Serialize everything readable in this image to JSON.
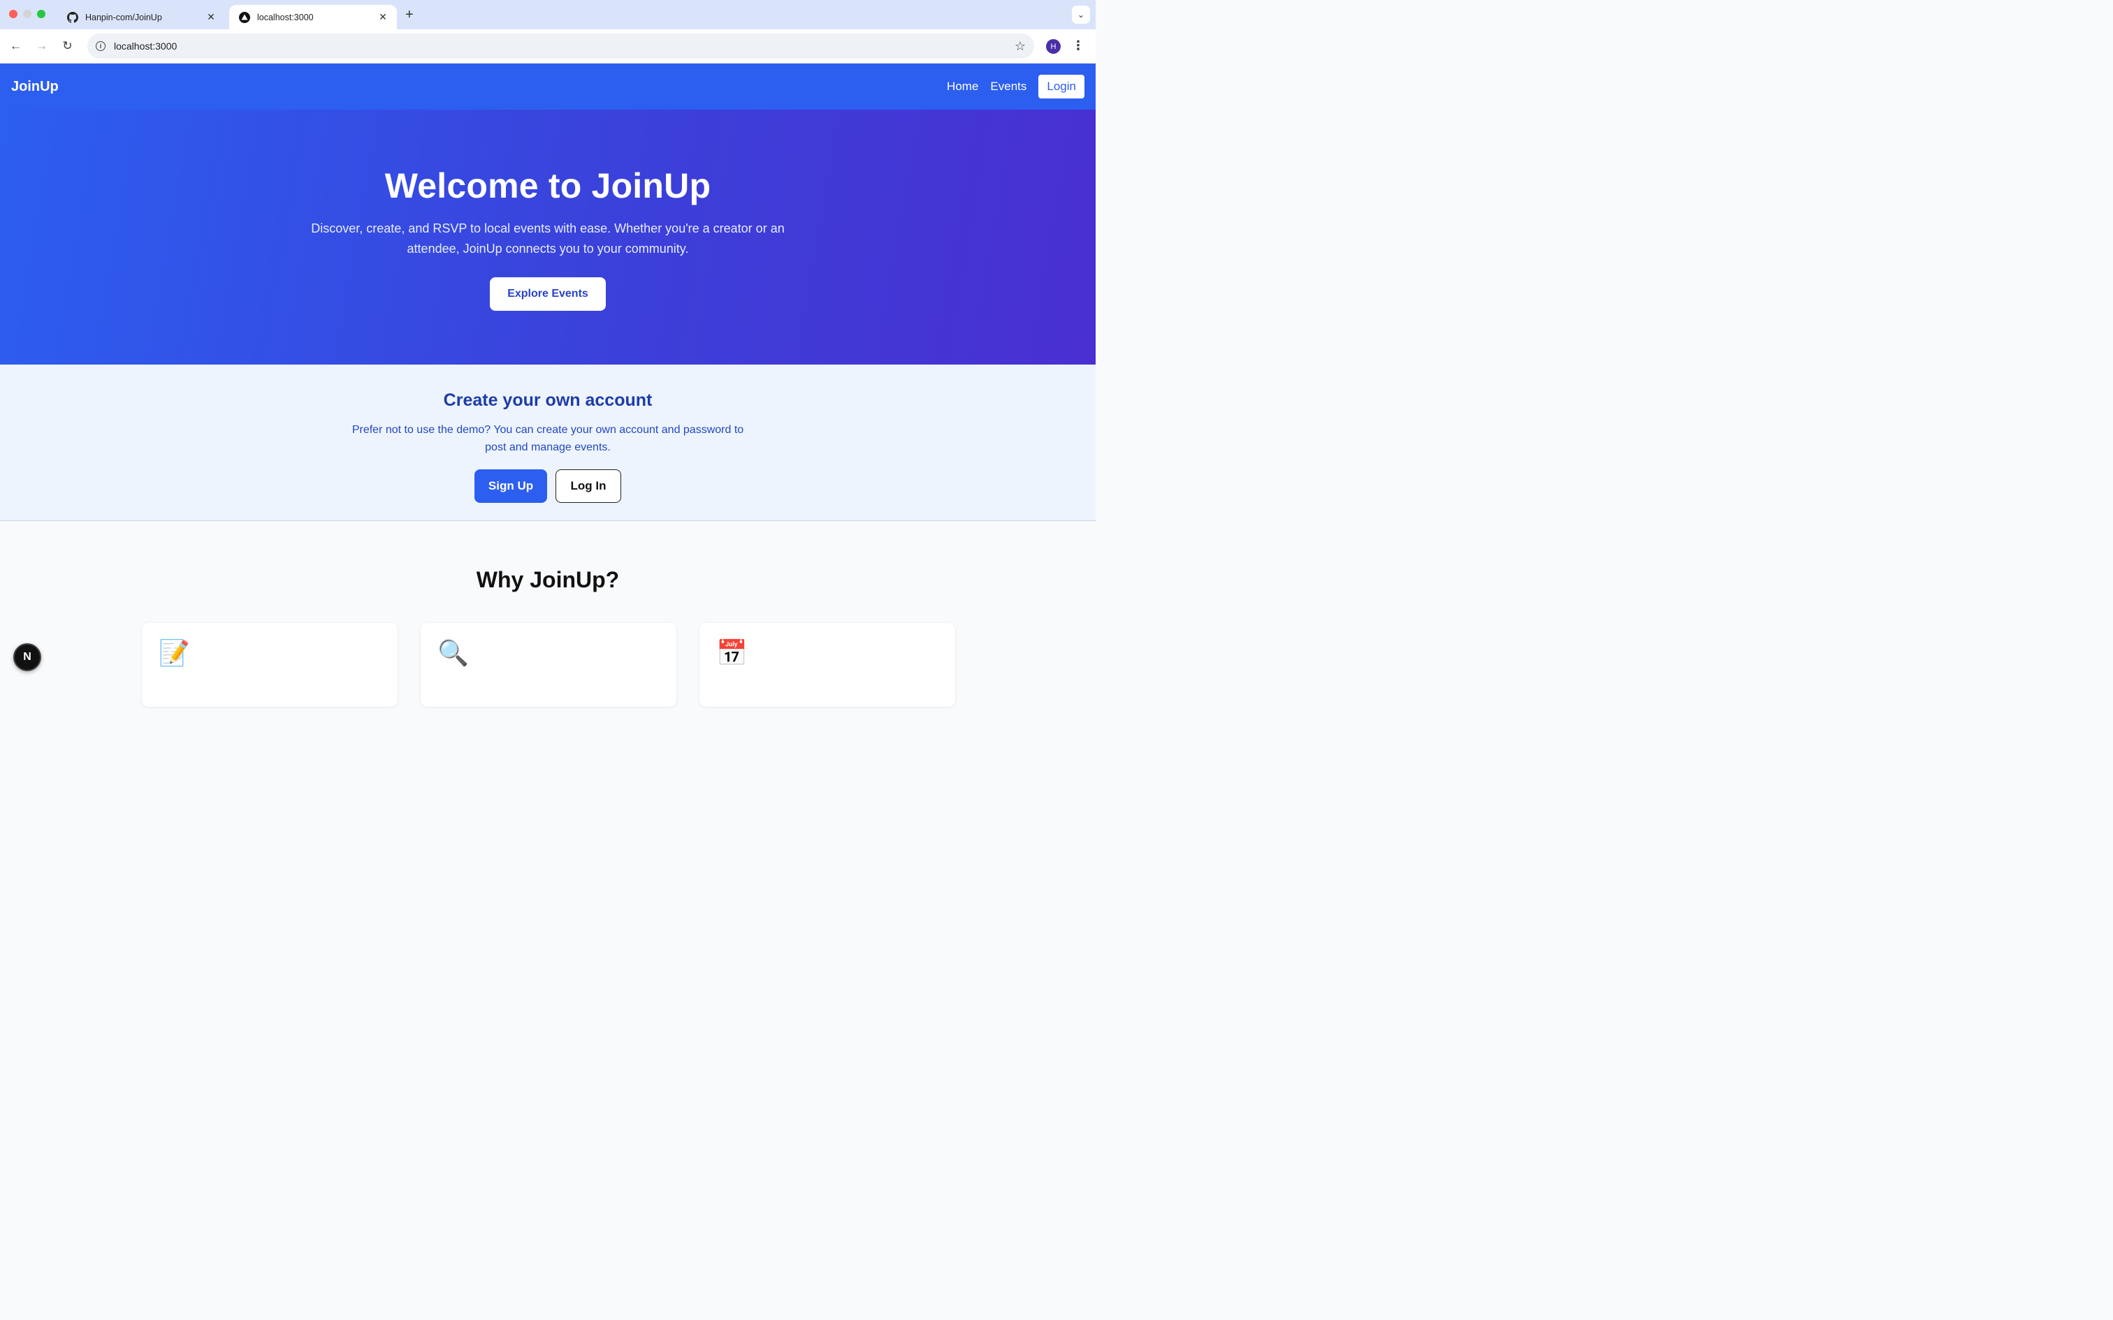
{
  "browser": {
    "tabs": [
      {
        "title": "Hanpin-com/JoinUp",
        "favicon": "github-icon",
        "active": false
      },
      {
        "title": "localhost:3000",
        "favicon": "nextjs-icon",
        "active": true
      }
    ],
    "url": "localhost:3000",
    "profile_initial": "H"
  },
  "navbar": {
    "brand": "JoinUp",
    "links": [
      "Home",
      "Events"
    ],
    "login_label": "Login"
  },
  "hero": {
    "title": "Welcome to JoinUp",
    "subtitle": "Discover, create, and RSVP to local events with ease. Whether you're a creator or an attendee, JoinUp connects you to your community.",
    "cta_label": "Explore Events"
  },
  "account": {
    "title": "Create your own account",
    "description": "Prefer not to use the demo? You can create your own account and password to post and manage events.",
    "signup_label": "Sign Up",
    "login_label": "Log In"
  },
  "why": {
    "title": "Why JoinUp?",
    "cards": [
      {
        "icon": "📝",
        "icon_name": "memo-icon"
      },
      {
        "icon": "🔍",
        "icon_name": "magnifier-icon"
      },
      {
        "icon": "📅",
        "icon_name": "calendar-icon"
      }
    ]
  },
  "devtools_badge": "N",
  "colors": {
    "brand_blue": "#2c5ef0",
    "hero_gradient_end": "#4a2fd2",
    "account_bg": "#eef4fd"
  }
}
